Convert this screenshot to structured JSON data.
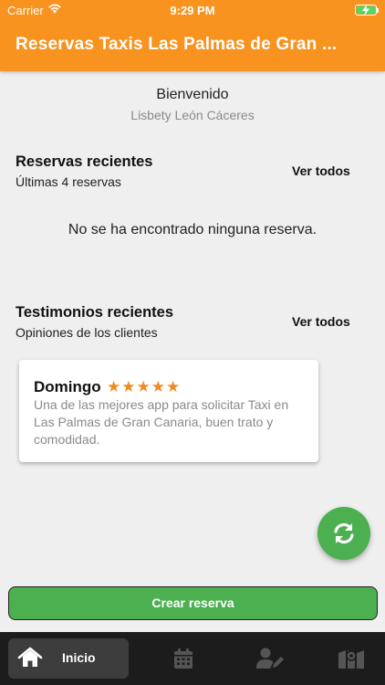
{
  "status_bar": {
    "carrier": "Carrier",
    "time": "9:29 PM"
  },
  "header": {
    "title": "Reservas Taxis Las Palmas de Gran ..."
  },
  "welcome": {
    "greeting": "Bienvenido",
    "user_name": "Lisbety León Cáceres"
  },
  "reservations": {
    "title": "Reservas recientes",
    "subtitle": "Últimas 4 reservas",
    "see_all": "Ver todos",
    "empty_message": "No se ha encontrado ninguna reserva."
  },
  "testimonials": {
    "title": "Testimonios recientes",
    "subtitle": "Opiniones de los clientes",
    "see_all": "Ver todos",
    "items": [
      {
        "name": "Domingo",
        "rating": 5,
        "stars": "★★★★★",
        "text": "Una de las mejores app para solicitar Taxi en Las Palmas de Gran Canaria, buen trato y comodidad."
      }
    ]
  },
  "fab": {
    "icon": "refresh-icon",
    "color": "#4caf50"
  },
  "create_button": {
    "label": "Crear reserva",
    "color": "#4caf50"
  },
  "bottom_nav": {
    "items": [
      {
        "icon": "home-icon",
        "label": "Inicio",
        "active": true
      },
      {
        "icon": "calendar-icon",
        "active": false
      },
      {
        "icon": "user-edit-icon",
        "active": false
      },
      {
        "icon": "map-icon",
        "active": false
      }
    ]
  },
  "colors": {
    "accent": "#f7931e",
    "star": "#f08a24",
    "nav_background": "#1c1c1c"
  }
}
